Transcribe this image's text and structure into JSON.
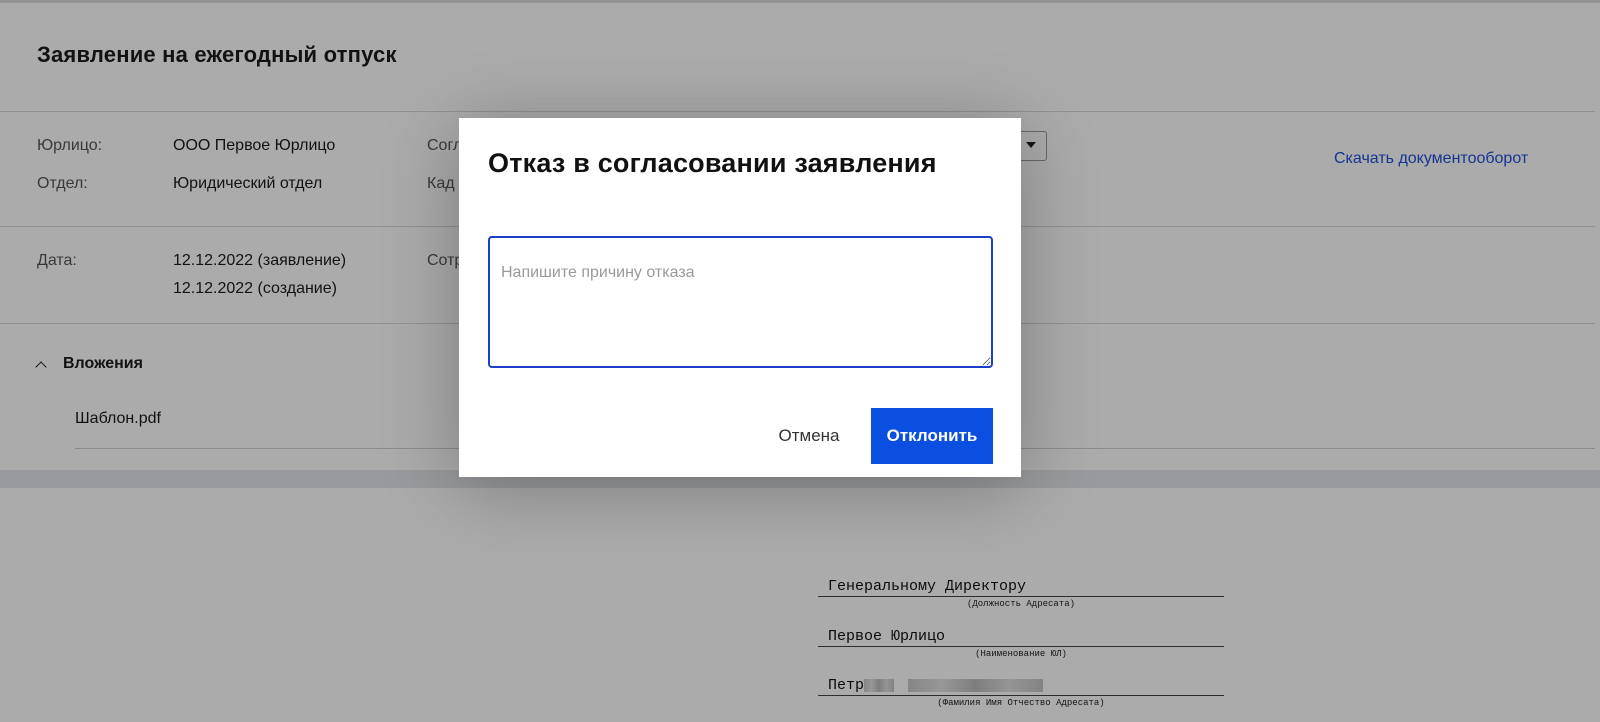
{
  "page": {
    "title": "Заявление на ежегодный отпуск"
  },
  "details": {
    "legal_entity_label": "Юрлицо:",
    "legal_entity_value": "ООО Первое Юрлицо",
    "department_label": "Отдел:",
    "department_value": "Юридический отдел",
    "approval_label_partial": "Согл",
    "hr_label_partial": "Кад",
    "date_label": "Дата:",
    "date_application": "12.12.2022 (заявление)",
    "date_created": "12.12.2022 (создание)",
    "employee_label_partial": "Сотр",
    "download_link": "Скачать документооборот"
  },
  "attachments": {
    "title": "Вложения",
    "files": [
      "Шаблон.pdf"
    ]
  },
  "document_preview": {
    "recipient_position": "Генеральному Директору",
    "recipient_position_caption": "(Должность Адресата)",
    "org_name": "Первое Юрлицо",
    "org_name_caption": "(Наименование ЮЛ)",
    "recipient_name_visible": "Петр",
    "recipient_name_caption": "(Фамилия Имя Отчество Адресата)"
  },
  "modal": {
    "title": "Отказ в согласовании заявления",
    "reason_placeholder": "Напишите причину отказа",
    "reason_value": "",
    "cancel_label": "Отмена",
    "reject_label": "Отклонить"
  },
  "colors": {
    "primary": "#0b4fe0",
    "focus_border": "#1b3fc7",
    "link": "#1e4fd9",
    "overlay": "rgba(0,0,0,0.33)"
  },
  "icons": {
    "collapse": "chevron-up-icon",
    "dropdown": "caret-down-icon",
    "resize": "resize-handle-icon"
  }
}
